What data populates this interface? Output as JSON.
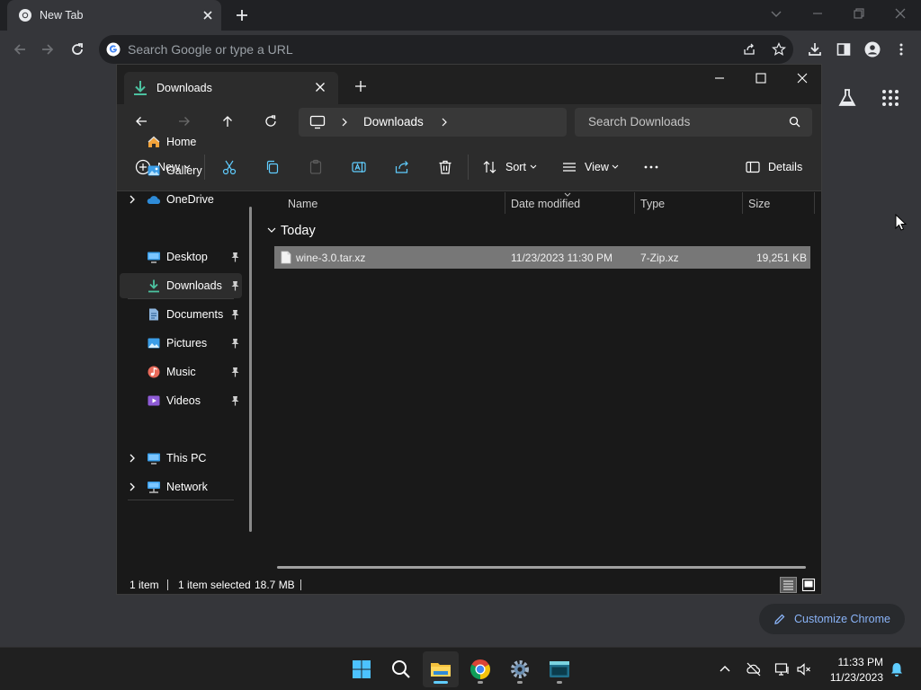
{
  "chrome": {
    "tab_title": "New Tab",
    "omnibox_placeholder": "Search Google or type a URL",
    "customize_label": "Customize Chrome"
  },
  "explorer": {
    "tab_title": "Downloads",
    "address": {
      "crumbs": [
        "Downloads"
      ]
    },
    "search_placeholder": "Search Downloads",
    "commands": {
      "new_label": "New",
      "sort_label": "Sort",
      "view_label": "View",
      "details_label": "Details"
    },
    "sidebar": {
      "items": [
        {
          "label": "Home",
          "icon": "home-icon"
        },
        {
          "label": "Gallery",
          "icon": "gallery-icon"
        },
        {
          "label": "OneDrive",
          "icon": "onedrive-icon",
          "expandable": true
        },
        {
          "label": "Desktop",
          "icon": "desktop-icon",
          "pinned": true
        },
        {
          "label": "Downloads",
          "icon": "downloads-icon",
          "pinned": true,
          "selected": true
        },
        {
          "label": "Documents",
          "icon": "documents-icon",
          "pinned": true
        },
        {
          "label": "Pictures",
          "icon": "pictures-icon",
          "pinned": true
        },
        {
          "label": "Music",
          "icon": "music-icon",
          "pinned": true
        },
        {
          "label": "Videos",
          "icon": "videos-icon",
          "pinned": true
        },
        {
          "label": "This PC",
          "icon": "this-pc-icon",
          "expandable": true
        },
        {
          "label": "Network",
          "icon": "network-icon",
          "expandable": true
        }
      ]
    },
    "columns": [
      "Name",
      "Date modified",
      "Type",
      "Size"
    ],
    "groups": [
      {
        "label": "Today",
        "files": [
          {
            "name": "wine-3.0.tar.xz",
            "date_modified": "11/23/2023 11:30 PM",
            "type": "7-Zip.xz",
            "size": "19,251 KB",
            "selected": true
          }
        ]
      }
    ],
    "status": {
      "item_count": "1 item",
      "selection": "1 item selected",
      "selection_size": "18.7 MB"
    }
  },
  "taskbar": {
    "apps": [
      "start-button",
      "search-button",
      "file-explorer",
      "google-chrome",
      "settings",
      "terminal"
    ],
    "active_app": "file-explorer",
    "clock": {
      "time": "11:33 PM",
      "date": "11/23/2023"
    }
  },
  "colors": {
    "accent": "#60cdff",
    "chrome_link": "#8ab4f8",
    "downloads_green": "#4cc2a0",
    "selection_row": "#777777"
  }
}
